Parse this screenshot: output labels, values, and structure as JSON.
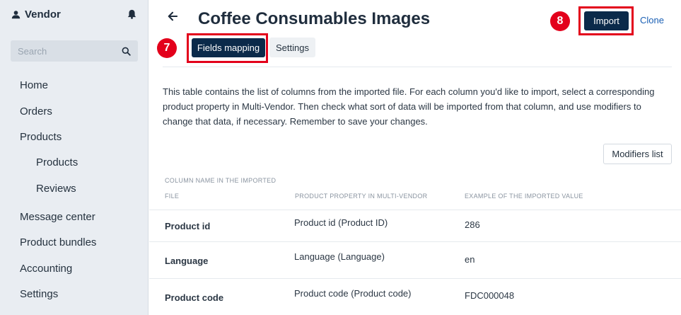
{
  "sidebar": {
    "brand": "Vendor",
    "search_placeholder": "Search",
    "items": [
      {
        "label": "Home"
      },
      {
        "label": "Orders"
      },
      {
        "label": "Products"
      },
      {
        "label": "Products"
      },
      {
        "label": "Reviews"
      },
      {
        "label": "Message center"
      },
      {
        "label": "Product bundles"
      },
      {
        "label": "Accounting"
      },
      {
        "label": "Settings"
      }
    ]
  },
  "header": {
    "title": "Coffee Consumables Images",
    "import_label": "Import",
    "clone_label": "Clone"
  },
  "tabs": [
    {
      "label": "Fields mapping"
    },
    {
      "label": "Settings"
    }
  ],
  "badges": {
    "step7": "7",
    "step8": "8"
  },
  "description": "This table contains the list of columns from the imported file. For each column you'd like to import, select a corresponding product property in Multi-Vendor. Then check what sort of data will be imported from that column, and use modifiers to change that data, if necessary. Remember to save your changes.",
  "modifiers_label": "Modifiers list",
  "table": {
    "headers": {
      "col1_line1": "COLUMN NAME IN THE IMPORTED",
      "col1_line2": "FILE",
      "col2": "PRODUCT PROPERTY IN MULTI-VENDOR",
      "col3": "EXAMPLE OF THE IMPORTED VALUE"
    },
    "rows": [
      {
        "column": "Product id",
        "property": "Product id (Product ID)",
        "example": "286"
      },
      {
        "column": "Language",
        "property": "Language (Language)",
        "example": "en"
      },
      {
        "column": "Product code",
        "property": "Product code (Product code)",
        "example": "FDC000048"
      }
    ]
  },
  "colors": {
    "primary": "#0b2a4a",
    "highlight": "#e3001b",
    "sidebar_bg": "#e9edf2"
  }
}
